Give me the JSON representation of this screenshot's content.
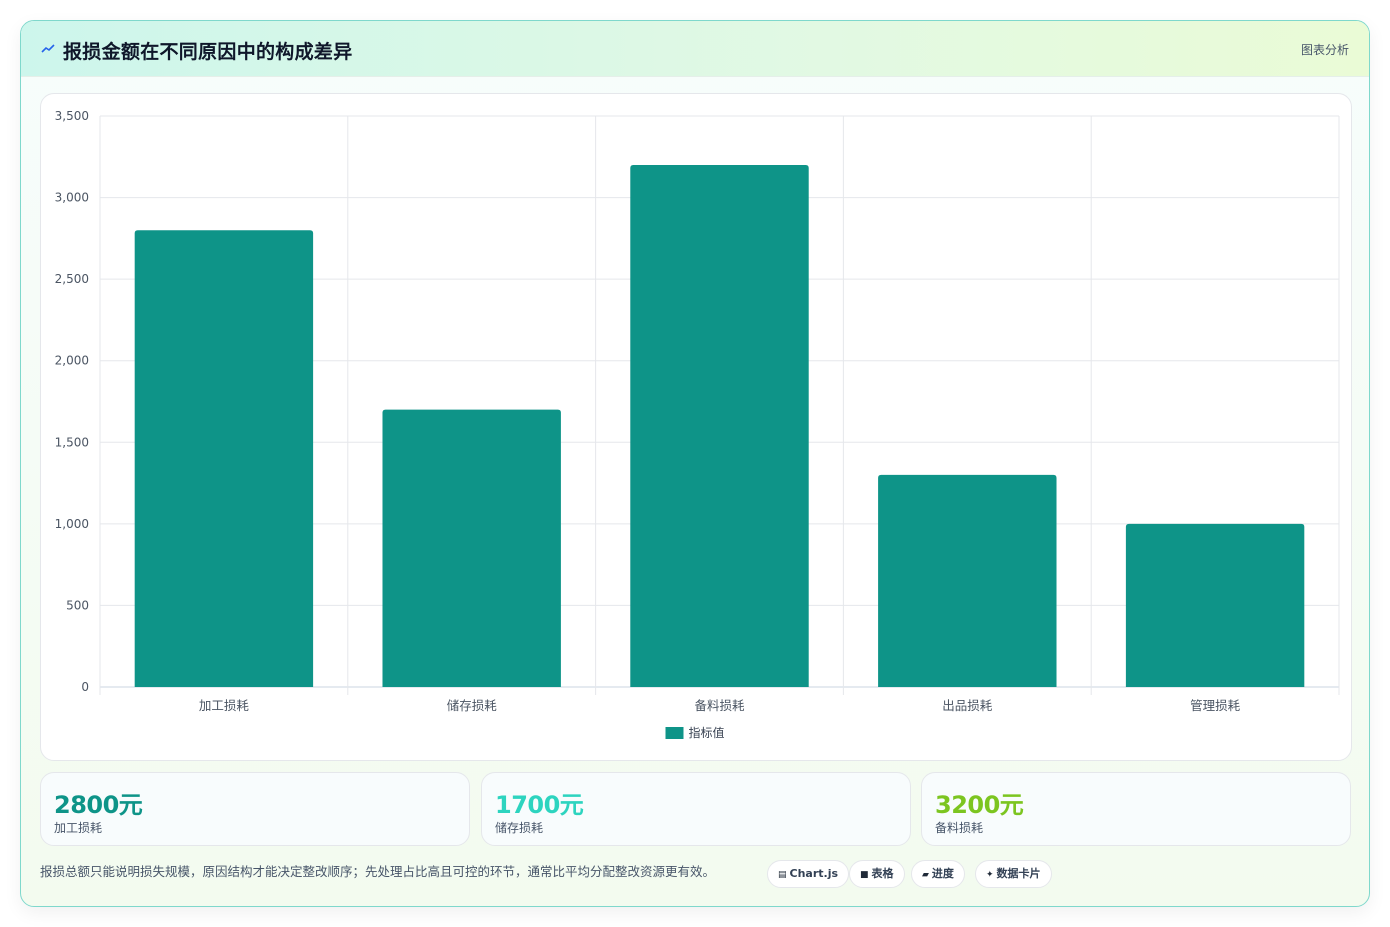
{
  "header": {
    "title_icon": "trend-line-icon",
    "title": "报损金额在不同原因中的构成差异",
    "tag": "图表分析"
  },
  "colors": {
    "bar": "#0e9488",
    "kpi_1": "#0e9488",
    "kpi_2": "#2dd4bf",
    "kpi_3": "#7cc520"
  },
  "chart_data": {
    "type": "bar",
    "categories": [
      "加工损耗",
      "储存损耗",
      "备料损耗",
      "出品损耗",
      "管理损耗"
    ],
    "series": [
      {
        "name": "指标值",
        "values": [
          2800,
          1700,
          3200,
          1300,
          1000
        ]
      }
    ],
    "ylim": [
      0,
      3500
    ],
    "yticks": [
      "0",
      "500",
      "1,000",
      "1,500",
      "2,000",
      "2,500",
      "3,000",
      "3,500"
    ],
    "grid": true,
    "legend": "bottom"
  },
  "kpis": [
    {
      "value": "2800元",
      "label": "加工损耗"
    },
    {
      "value": "1700元",
      "label": "储存损耗"
    },
    {
      "value": "3200元",
      "label": "备料损耗"
    }
  ],
  "note": "报损总额只能说明损失规模，原因结构才能决定整改顺序；先处理占比高且可控的环节，通常比平均分配整改资源更有效。",
  "chips": [
    {
      "icon": "chart-icon",
      "glyph": "▤",
      "label": "Chart.js"
    },
    {
      "icon": "table-icon",
      "glyph": "■",
      "label": "表格"
    },
    {
      "icon": "progress-icon",
      "glyph": "▰",
      "label": "进度"
    },
    {
      "icon": "sparkle-icon",
      "glyph": "✦",
      "label": "数据卡片"
    }
  ]
}
